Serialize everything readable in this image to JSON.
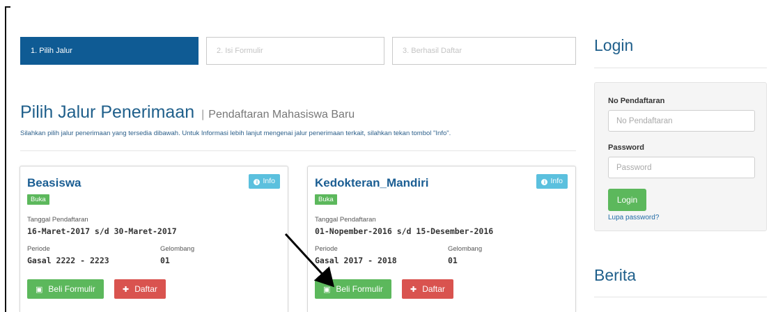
{
  "steps": [
    {
      "label": "1. Pilih Jalur",
      "active": true
    },
    {
      "label": "2. Isi Formulir",
      "active": false
    },
    {
      "label": "3. Berhasil Daftar",
      "active": false
    }
  ],
  "page": {
    "title": "Pilih Jalur Penerimaan",
    "separator": "|",
    "subtitle": "Pendaftaran Mahasiswa Baru",
    "description": "Silahkan pilih jalur penerimaan yang tersedia dibawah. Untuk Informasi lebih lanjut mengenai jalur penerimaan terkait, silahkan tekan tombol \"Info\"."
  },
  "cards": [
    {
      "title": "Beasiswa",
      "info_label": "Info",
      "status": "Buka",
      "date_label": "Tanggal Pendaftaran",
      "date_value": "16-Maret-2017 s/d 30-Maret-2017",
      "period_label": "Periode",
      "period_value": "Gasal 2222 - 2223",
      "wave_label": "Gelombang",
      "wave_value": "01",
      "buy_label": "Beli Formulir",
      "register_label": "Daftar"
    },
    {
      "title": "Kedokteran_Mandiri",
      "info_label": "Info",
      "status": "Buka",
      "date_label": "Tanggal Pendaftaran",
      "date_value": "01-Nopember-2016 s/d 15-Desember-2016",
      "period_label": "Periode",
      "period_value": "Gasal 2017 - 2018",
      "wave_label": "Gelombang",
      "wave_value": "01",
      "buy_label": "Beli Formulir",
      "register_label": "Daftar"
    }
  ],
  "sidebar": {
    "login_title": "Login",
    "reg_label": "No Pendaftaran",
    "reg_placeholder": "No Pendaftaran",
    "password_label": "Password",
    "password_placeholder": "Password",
    "login_button": "Login",
    "forgot_link": "Lupa password?",
    "news_title": "Berita"
  },
  "colors": {
    "primary": "#0f5b94",
    "success": "#5cb85c",
    "danger": "#d9534f",
    "info": "#5bc0de"
  },
  "icons": {
    "info": "info-circle-icon",
    "buy": "money-icon",
    "register": "user-plus-icon"
  }
}
